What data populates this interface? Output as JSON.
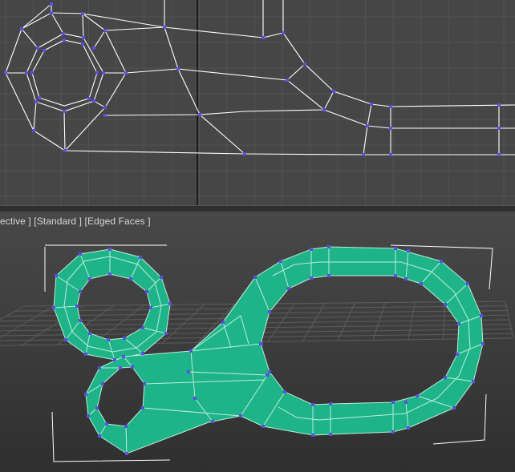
{
  "viewports": {
    "top": {
      "name": "top-view"
    },
    "perspective": {
      "label_parts": [
        "ective ]",
        "[Standard ]",
        "[Edged Faces ]"
      ]
    }
  },
  "colors": {
    "viewport_bg": "#464646",
    "grid_line": "#525252",
    "wire": "#ffffff",
    "vertex": "#5a4fe0",
    "poly_fill": "#1fb487",
    "poly_edge": "#b8eedd"
  }
}
